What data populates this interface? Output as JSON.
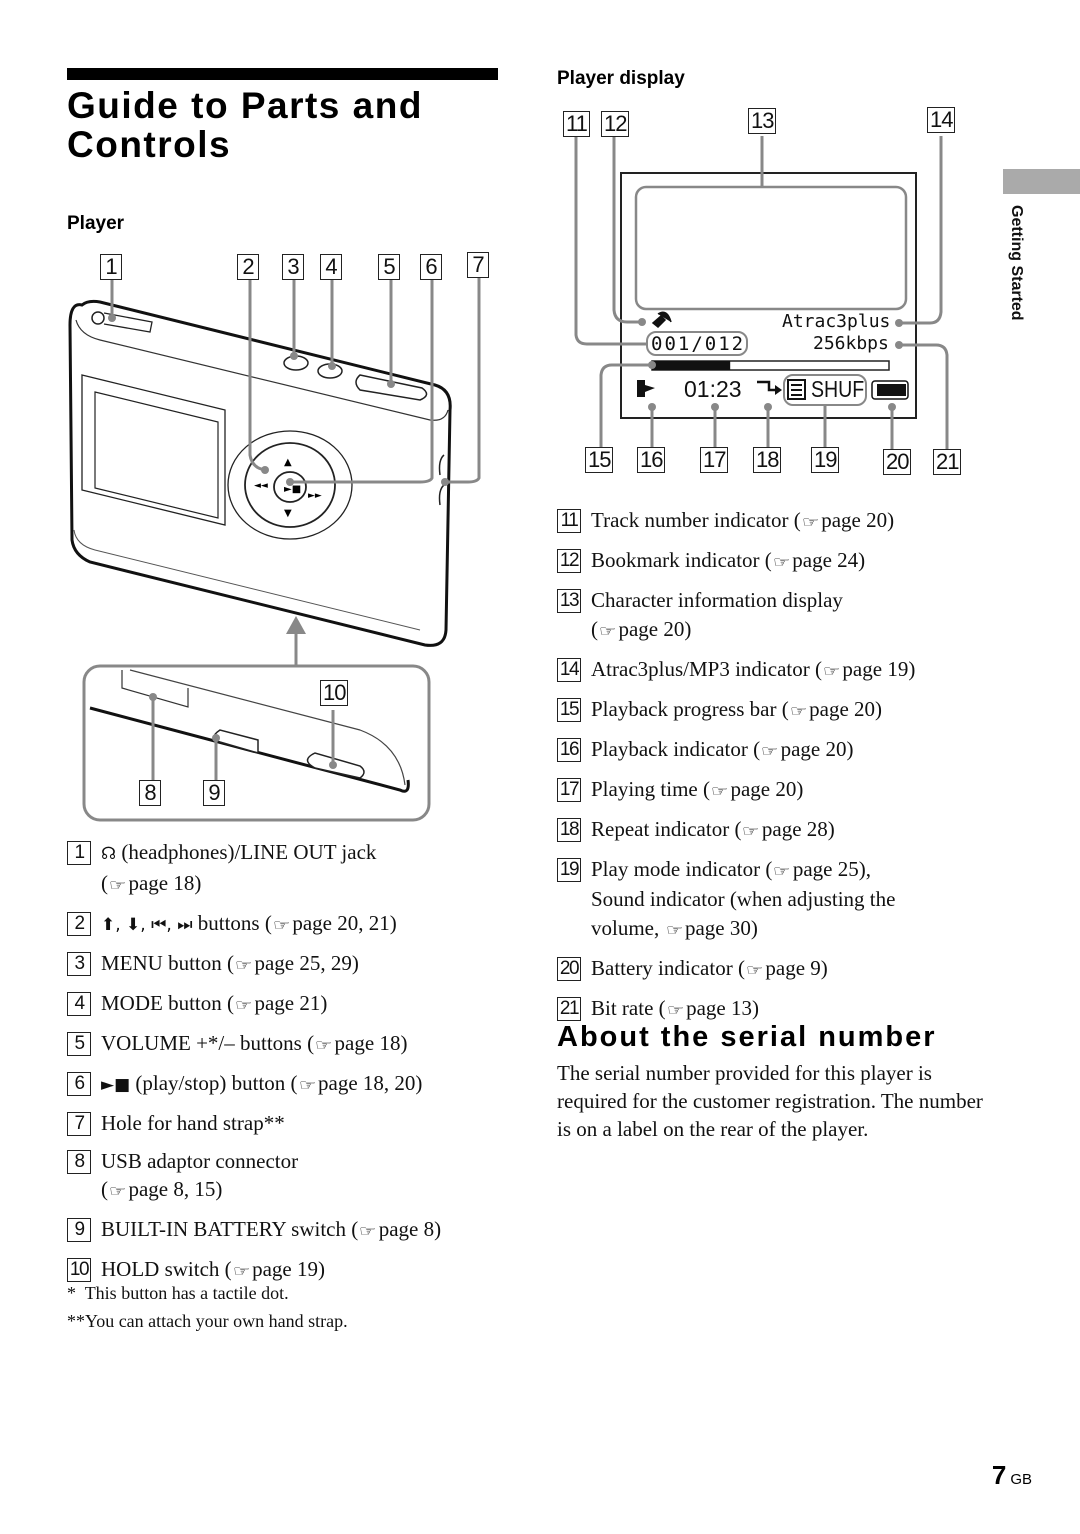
{
  "page": {
    "title_line1": "Guide to Parts and",
    "title_line2": "Controls",
    "side_tab_label": "Getting Started",
    "page_number": "7",
    "page_suffix": "GB"
  },
  "player_section": {
    "label": "Player",
    "callouts": [
      "1",
      "2",
      "3",
      "4",
      "5",
      "6",
      "7",
      "8",
      "9",
      "10"
    ],
    "items": [
      {
        "num": "1",
        "icon": "headphones-icon",
        "icon_glyph": "☊",
        "text": "(headphones)/LINE OUT jack",
        "ref": "page 18)",
        "ref_prefix": "("
      },
      {
        "num": "2",
        "icon_glyphs": "⬆, ⬇, ⏮, ⏭",
        "text": "buttons (",
        "ref": "page 20, 21)"
      },
      {
        "num": "3",
        "text": "MENU button (",
        "ref": "page 25, 29)"
      },
      {
        "num": "4",
        "text": "MODE button (",
        "ref": "page 21)"
      },
      {
        "num": "5",
        "text": "VOLUME +*/– buttons (",
        "ref": "page 18)"
      },
      {
        "num": "6",
        "icon_glyph": "►■",
        "text": "(play/stop) button (",
        "ref": "page 18, 20)"
      },
      {
        "num": "7",
        "text": "Hole for hand strap**"
      },
      {
        "num": "8",
        "text": "USB adaptor connector",
        "ref_prefix": "(",
        "ref": "page 8, 15)"
      },
      {
        "num": "9",
        "text": "BUILT-IN BATTERY switch (",
        "ref": "page 8)"
      },
      {
        "num": "10",
        "text": "HOLD switch (",
        "ref": "page 19)"
      }
    ],
    "footnotes": [
      {
        "mark": "*",
        "text": "This button has a tactile dot."
      },
      {
        "mark": "**",
        "text": "You can attach your own hand strap."
      }
    ]
  },
  "display_section": {
    "label": "Player display",
    "callouts": [
      "11",
      "12",
      "13",
      "14",
      "15",
      "16",
      "17",
      "18",
      "19",
      "20",
      "21"
    ],
    "lcd": {
      "codec": "Atrac3plus",
      "track": "001/012",
      "bitrate": "256kbps",
      "progress_fraction": 0.33,
      "time": "01:23",
      "play_mode": "SHUF"
    },
    "items": [
      {
        "num": "11",
        "text": "Track number indicator (",
        "ref": "page 20)"
      },
      {
        "num": "12",
        "text": "Bookmark indicator (",
        "ref": "page 24)"
      },
      {
        "num": "13",
        "text": "Character information display",
        "ref_prefix": "(",
        "ref": "page 20)"
      },
      {
        "num": "14",
        "text": "Atrac3plus/MP3 indicator (",
        "ref": "page 19)"
      },
      {
        "num": "15",
        "text": "Playback progress bar (",
        "ref": "page 20)"
      },
      {
        "num": "16",
        "text": "Playback indicator (",
        "ref": "page 20)"
      },
      {
        "num": "17",
        "text": "Playing time (",
        "ref": "page 20)"
      },
      {
        "num": "18",
        "text": "Repeat indicator (",
        "ref": "page 28)"
      },
      {
        "num": "19",
        "text": "Play mode indicator (",
        "ref": "page 25),",
        "line2": "Sound indicator (when adjusting the",
        "line3_prefix": "volume, ",
        "line3_ref": "page 30)"
      },
      {
        "num": "20",
        "text": "Battery indicator (",
        "ref": "page 9)"
      },
      {
        "num": "21",
        "text": "Bit rate (",
        "ref": "page 13)"
      }
    ]
  },
  "serial": {
    "heading": "About the serial number",
    "body": "The serial number provided for this player is required for the customer registration. The number is on a label on the rear of the player."
  },
  "pointer_glyph": "☞"
}
